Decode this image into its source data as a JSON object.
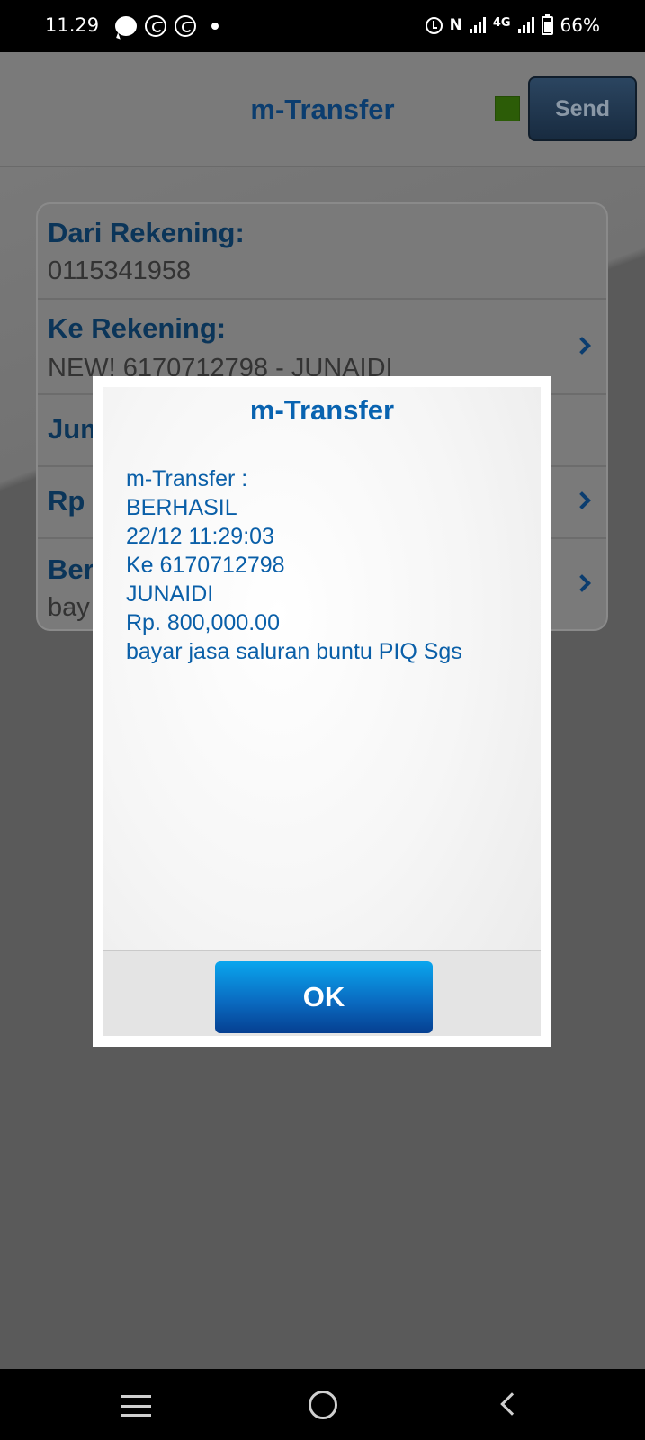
{
  "status_bar": {
    "time": "11.29",
    "network": "4G",
    "battery": "66%",
    "left_icons": [
      "message-icon",
      "whatsapp-icon",
      "whatsapp-business-icon",
      "notification-dot-icon"
    ],
    "right_icons": [
      "alarm-icon",
      "nfc-icon",
      "signal-icon",
      "signal-icon",
      "battery-icon"
    ]
  },
  "header": {
    "title": "m-Transfer",
    "send_label": "Send",
    "indicator_color": "#2c5c07"
  },
  "form": {
    "rows": [
      {
        "label": "Dari Rekening:",
        "value": "0115341958"
      },
      {
        "label": "Ke Rekening:",
        "value": "NEW! 6170712798 - JUNAIDI"
      },
      {
        "label": "Jum",
        "value": ""
      },
      {
        "label": "Rp",
        "value": ""
      },
      {
        "label": "Ber",
        "value": "bay"
      }
    ]
  },
  "dialog": {
    "title": "m-Transfer",
    "message_lines": [
      "m-Transfer :",
      "BERHASIL",
      "22/12 11:29:03",
      "Ke 6170712798",
      "JUNAIDI",
      "Rp. 800,000.00",
      "bayar jasa saluran buntu PIQ Sgs"
    ],
    "ok_label": "OK"
  },
  "colors": {
    "title_blue": "#0b3d6f",
    "dialog_text": "#0a5fa8",
    "ok_button": "#0a6cc2"
  },
  "nav_bar": {
    "icons": [
      "menu-icon",
      "home-icon",
      "back-icon"
    ]
  }
}
